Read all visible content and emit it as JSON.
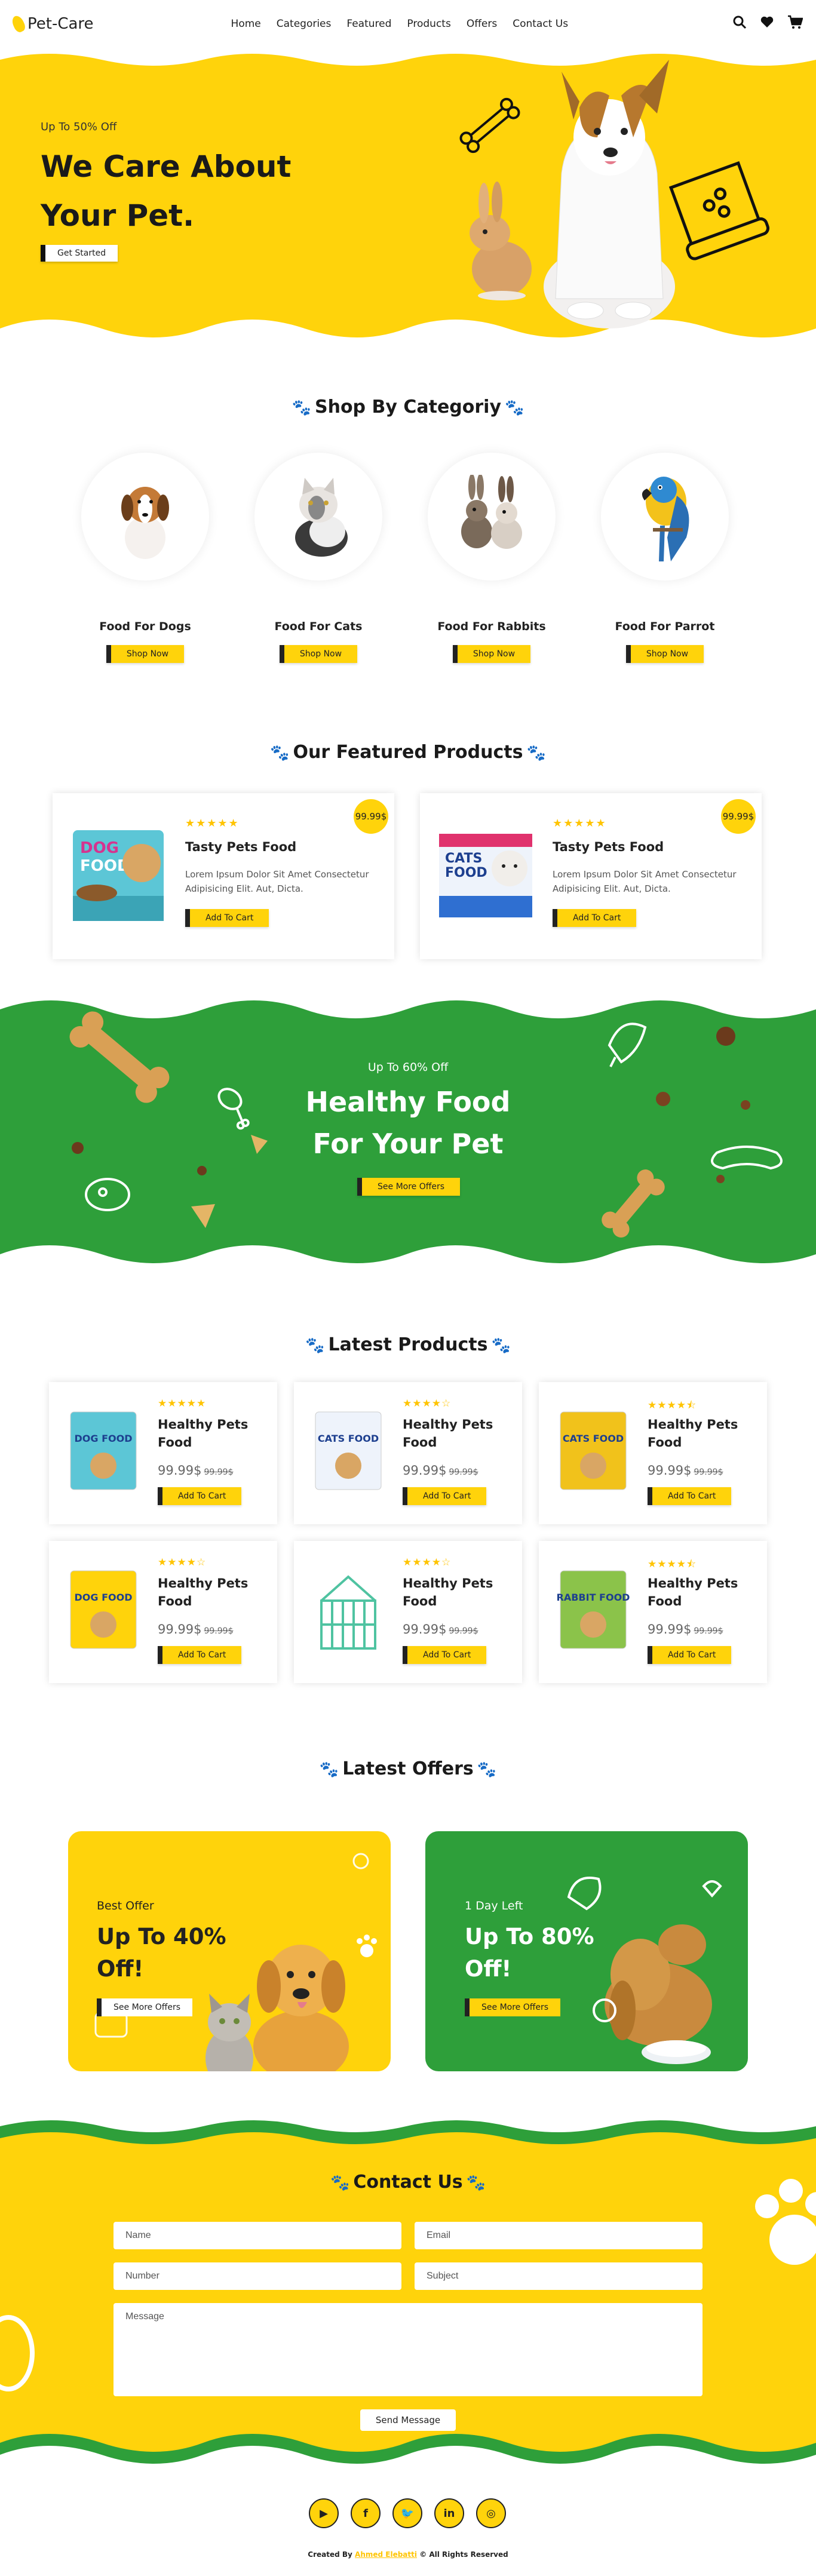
{
  "nav": {
    "logo_text": "Pet-Care",
    "links": [
      "Home",
      "Categories",
      "Featured",
      "Products",
      "Offers",
      "Contact Us"
    ],
    "icons": [
      "search-icon",
      "heart-icon",
      "cart-icon"
    ]
  },
  "hero": {
    "subtitle": "Up To 50% Off",
    "title": "We Care About Your Pet.",
    "button": "Get Started"
  },
  "categories": {
    "title": "Shop By Categoriy",
    "items": [
      {
        "name": "Food For Dogs",
        "button": "Shop Now"
      },
      {
        "name": "Food For Cats",
        "button": "Shop Now"
      },
      {
        "name": "Food For Rabbits",
        "button": "Shop Now"
      },
      {
        "name": "Food For Parrot",
        "button": "Shop Now"
      }
    ]
  },
  "featured": {
    "title": "Our Featured Products",
    "items": [
      {
        "name": "Tasty Pets Food",
        "price": "99.99$",
        "rating": 5,
        "desc": "Lorem Ipsum Dolor Sit Amet Consectetur Adipisicing Elit. Aut, Dicta.",
        "button": "Add To Cart",
        "package": "DOG FOOD"
      },
      {
        "name": "Tasty Pets Food",
        "price": "99.99$",
        "rating": 5,
        "desc": "Lorem Ipsum Dolor Sit Amet Consectetur Adipisicing Elit. Aut, Dicta.",
        "button": "Add To Cart",
        "package": "CATS FOOD"
      }
    ]
  },
  "banner": {
    "subtitle": "Up To 60% Off",
    "title": "Healthy Food For Your Pet",
    "button": "See More Offers"
  },
  "latest": {
    "title": "Latest Products",
    "items": [
      {
        "name": "Healthy Pets Food",
        "price": "99.99$",
        "old_price": "99.99$",
        "rating": 5,
        "button": "Add To Cart",
        "package": "DOG FOOD"
      },
      {
        "name": "Healthy Pets Food",
        "price": "99.99$",
        "old_price": "99.99$",
        "rating": 4,
        "button": "Add To Cart",
        "package": "CATS FOOD"
      },
      {
        "name": "Healthy Pets Food",
        "price": "99.99$",
        "old_price": "99.99$",
        "rating": 4.5,
        "button": "Add To Cart",
        "package": "CATS FOOD"
      },
      {
        "name": "Healthy Pets Food",
        "price": "99.99$",
        "old_price": "99.99$",
        "rating": 4,
        "button": "Add To Cart",
        "package": "DOG FOOD"
      },
      {
        "name": "Healthy Pets Food",
        "price": "99.99$",
        "old_price": "99.99$",
        "rating": 4,
        "button": "Add To Cart",
        "package": ""
      },
      {
        "name": "Healthy Pets Food",
        "price": "99.99$",
        "old_price": "99.99$",
        "rating": 4.5,
        "button": "Add To Cart",
        "package": "RABBIT FOOD"
      }
    ]
  },
  "offers": {
    "title": "Latest Offers",
    "items": [
      {
        "subtitle": "Best Offer",
        "title": "Up To 40% Off!",
        "button": "See More Offers"
      },
      {
        "subtitle": "1 Day Left",
        "title": "Up To 80% Off!",
        "button": "See More Offers"
      }
    ]
  },
  "contact": {
    "title": "Contact Us",
    "name_placeholder": "Name",
    "email_placeholder": "Email",
    "number_placeholder": "Number",
    "subject_placeholder": "Subject",
    "message_placeholder": "Message",
    "button": "Send Message"
  },
  "footer": {
    "social_icons": [
      "youtube-icon",
      "facebook-icon",
      "twitter-icon",
      "linkedin-icon",
      "instagram-icon"
    ],
    "prefix": "Created By",
    "author": "Ahmed Elebatti",
    "suffix": "© All Rights Reserved"
  },
  "colors": {
    "accent": "#ffd30b",
    "green": "#2e9f3a",
    "dark": "#222222"
  }
}
